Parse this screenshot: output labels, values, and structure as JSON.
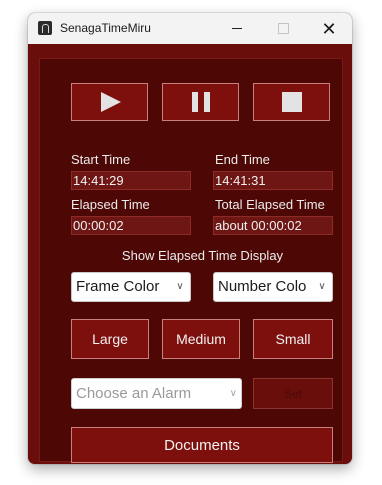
{
  "window": {
    "title": "SenagaTimeMiru",
    "close_glyph": "✕",
    "minimize_glyph": "—",
    "maximize_glyph": "☐"
  },
  "controls": {
    "play_icon": "play-icon",
    "pause_icon": "pause-icon",
    "stop_icon": "stop-icon"
  },
  "times": {
    "start_label": "Start Time",
    "start_value": "14:41:29",
    "end_label": "End Time",
    "end_value": "14:41:31",
    "elapsed_label": "Elapsed Time",
    "elapsed_value": "00:00:02",
    "total_label": "Total Elapsed Time",
    "total_value": "about 00:00:02"
  },
  "display": {
    "heading": "Show Elapsed Time Display",
    "frame_color": "Frame Color",
    "number_color": "Number Colo"
  },
  "sizes": {
    "large": "Large",
    "medium": "Medium",
    "small": "Small"
  },
  "alarm": {
    "placeholder": "Choose an Alarm",
    "set_label": "Set"
  },
  "documents_label": "Documents",
  "colors": {
    "frame": "#6a0e0c",
    "panel": "#4d0806",
    "button": "#7d0f0d",
    "button_border": "#c9807d"
  }
}
